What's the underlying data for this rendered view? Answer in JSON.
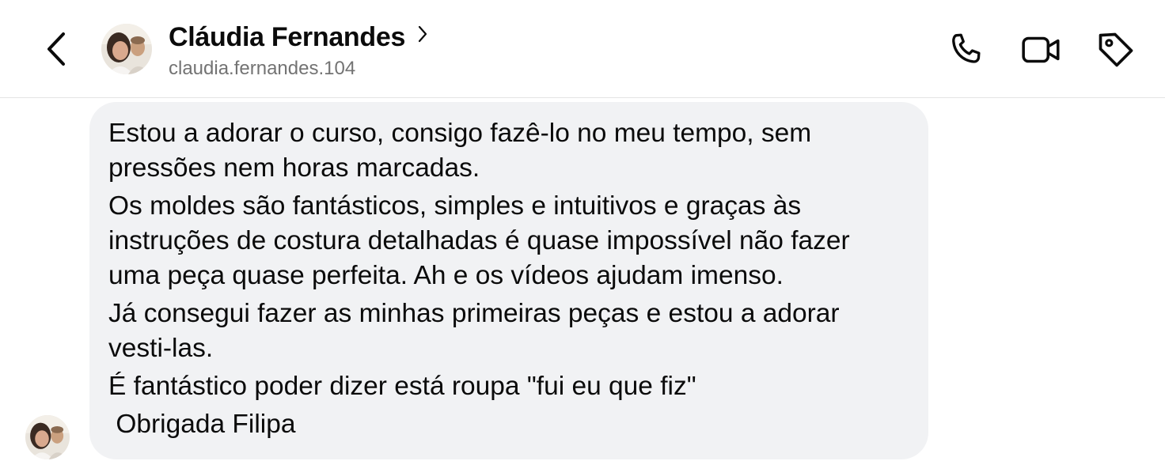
{
  "header": {
    "back_icon": "chevron-left-icon",
    "contact_name": "Cláudia Fernandes",
    "contact_handle": "claudia.fernandes.104",
    "actions": [
      {
        "icon": "phone-icon"
      },
      {
        "icon": "video-camera-icon"
      },
      {
        "icon": "tag-icon"
      }
    ]
  },
  "message": {
    "paragraphs": [
      "Estou a adorar o curso, consigo fazê-lo no meu tempo, sem\npressões nem horas marcadas.",
      "Os moldes são fantásticos, simples e intuitivos e graças às\ninstruções de costura detalhadas é quase impossível não fazer\numa peça quase perfeita. Ah e os vídeos ajudam imenso.",
      "Já consegui fazer as minhas primeiras peças e estou a adorar\nvesti-las.",
      "É fantástico poder dizer está roupa \"fui eu que fiz\"",
      " Obrigada Filipa"
    ]
  },
  "colors": {
    "bubble_background": "#f1f2f4",
    "text_primary": "#0b0b0b",
    "text_secondary": "#737373",
    "divider": "#e4e4e4"
  }
}
